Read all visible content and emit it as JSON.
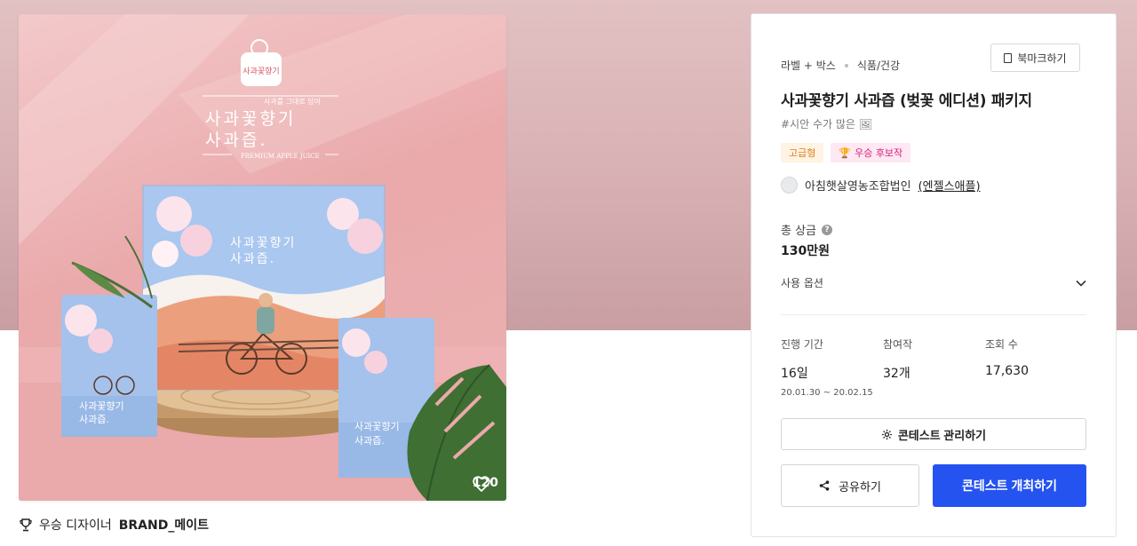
{
  "product": {
    "likes": "120",
    "winner_label": "우승 디자이너",
    "winner_name": "BRAND_메이트"
  },
  "artwork": {
    "logo_text": "사과꽃향기",
    "subtitle": "사과를 그대로 담아",
    "title_line1": "사과꽃향기",
    "title_line2": "사과즙.",
    "english": "PREMIUM APPLE JUICE"
  },
  "info": {
    "category_1": "라벨 + 박스",
    "category_2": "식품/건강",
    "bookmark_label": "북마크하기",
    "title": "사과꽃향기 사과즙 (벚꽃 에디션) 패키지",
    "tagline": "#시안 수가 많은 🖼",
    "tag_premium": "고급형",
    "tag_candidate": "우승 후보작",
    "owner_name": "아침햇살영농조합법인",
    "owner_handle": "(엔젤스애플)",
    "prize_label": "총 상금",
    "prize_value": "130만원",
    "usage_label": "사용 옵션",
    "stats": [
      {
        "label": "진행 기간",
        "value": "16일",
        "sub": "20.01.30 ~ 20.02.15"
      },
      {
        "label": "참여작",
        "value": "32개",
        "sub": ""
      },
      {
        "label": "조회 수",
        "value": "17,630",
        "sub": ""
      }
    ],
    "manage_label": "콘테스트 관리하기",
    "share_label": "공유하기",
    "host_label": "콘테스트 개최하기"
  },
  "colors": {
    "primary": "#2453f0",
    "premium_tag": "#d9821e",
    "candidate_tag": "#d4237a",
    "hero_bg": "#d8b0b3"
  }
}
